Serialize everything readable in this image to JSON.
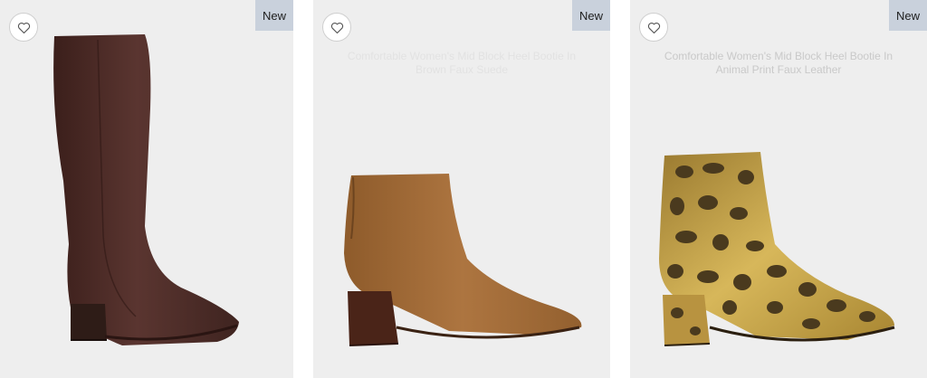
{
  "products": [
    {
      "badge": "New",
      "title": "",
      "icons": {
        "favorite": "heart-outline-icon"
      },
      "colors": {
        "shoe": "#4e2c27",
        "heel": "#3a2520"
      }
    },
    {
      "badge": "New",
      "title": "Comfortable Women's Mid Block Heel Bootie In Brown Faux Suede",
      "icons": {
        "favorite": "heart-outline-icon"
      },
      "colors": {
        "shoe": "#a06a34",
        "heel": "#4a2418"
      }
    },
    {
      "badge": "New",
      "title": "Comfortable Women's Mid Block Heel Bootie In Animal Print Faux Leather",
      "icons": {
        "favorite": "heart-outline-icon"
      },
      "colors": {
        "shoe": "#c2a044",
        "spots": "#4a3a1e"
      }
    }
  ]
}
